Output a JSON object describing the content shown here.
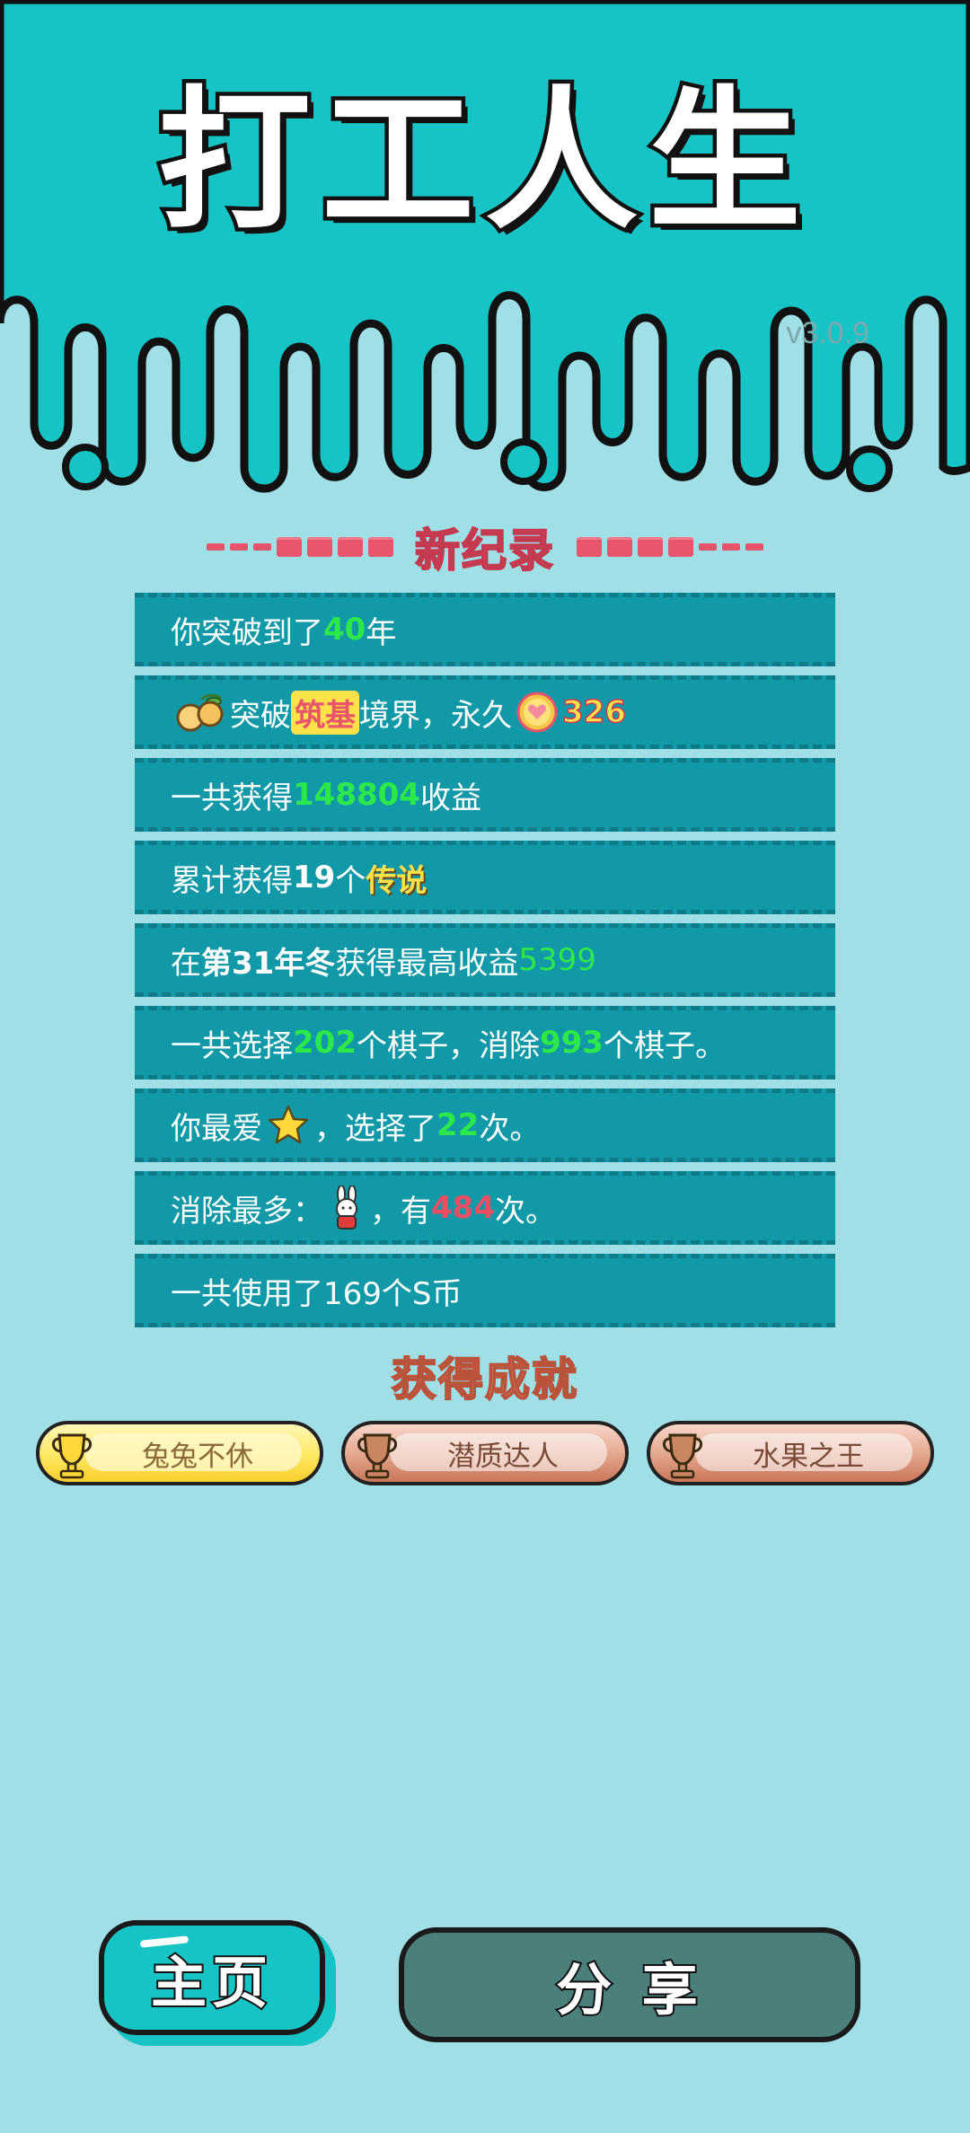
{
  "header": {
    "title": "打工人生",
    "version": "v3.0.9"
  },
  "records": {
    "heading": "新纪录",
    "rows": [
      {
        "pre": "你突破到了",
        "value": "40",
        "post": "年"
      },
      {
        "icon": "peach-icon",
        "pre": "突破",
        "realm": "筑基",
        "mid": "境界，永久",
        "coin_icon": "heart-coin-icon",
        "value": "326"
      },
      {
        "pre": "一共获得",
        "value": "148804",
        "post": "收益"
      },
      {
        "pre": "累计获得",
        "count": "19",
        "mid": "个",
        "rarity": "传说"
      },
      {
        "pre": "在 ",
        "season": "第31年冬",
        "mid": " 获得最高收益",
        "value": "5399"
      },
      {
        "pre": "一共选择",
        "chosen": "202",
        "mid": "个棋子，消除",
        "removed": "993",
        "post": "个棋子。"
      },
      {
        "pre": "你最爱",
        "icon": "star-icon",
        "mid": "，选择了",
        "value": "22",
        "post": "次。"
      },
      {
        "pre": "消除最多：",
        "icon": "rabbit-icon",
        "mid": "，有",
        "value": "484",
        "post": "次。"
      },
      {
        "text": "一共使用了169个S币"
      }
    ]
  },
  "achievements": {
    "title": "获得成就",
    "items": [
      {
        "label": "兔兔不休",
        "tier": "gold"
      },
      {
        "label": "潜质达人",
        "tier": "bronze"
      },
      {
        "label": "水果之王",
        "tier": "bronze"
      }
    ]
  },
  "buttons": {
    "home": "主页",
    "share": "分 享"
  },
  "colors": {
    "header_teal": "#16c4c6",
    "background": "#a0dfe6",
    "row_bg": "#1199a8",
    "highlight_green": "#2de84a",
    "highlight_red": "#ee4d62",
    "heading_pink": "#e8546b",
    "share_button": "#4b7f7a"
  }
}
